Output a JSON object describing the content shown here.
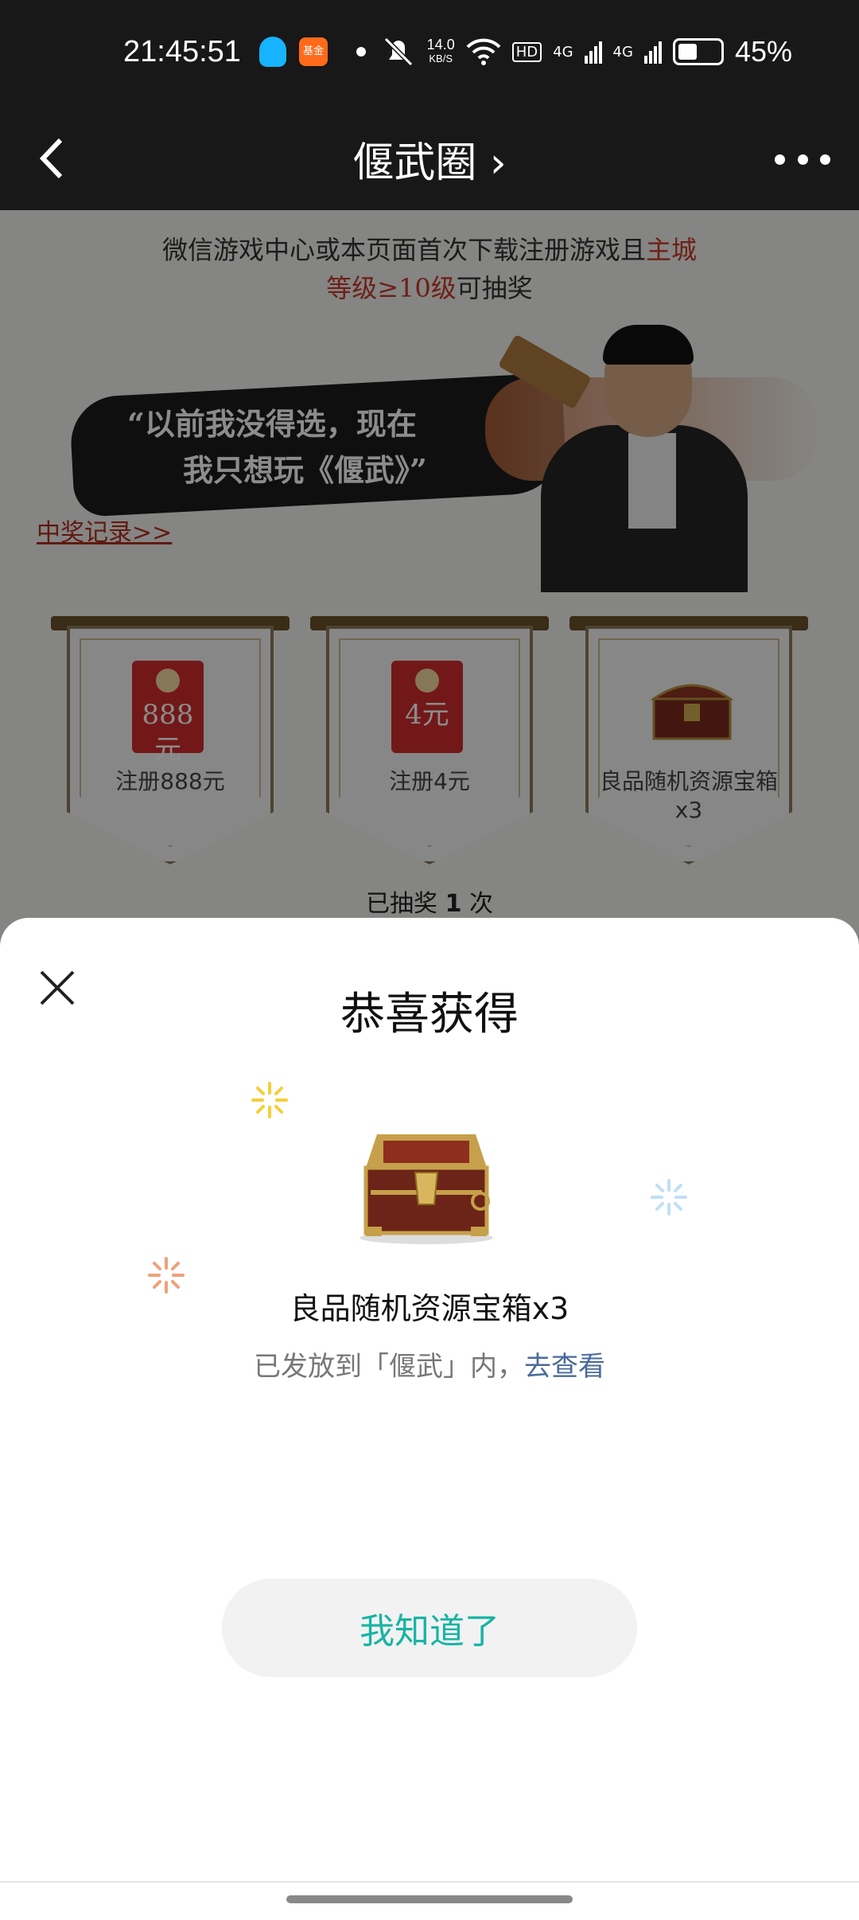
{
  "status_bar": {
    "time": "21:45:51",
    "fund_badge": "基金",
    "net_speed_value": "14.0",
    "net_speed_unit": "KB/S",
    "hd_label": "HD",
    "network_1": "4G",
    "network_2": "4G",
    "battery_percent": "45%",
    "battery_level": 0.45
  },
  "nav": {
    "title": "偃武圈 ›"
  },
  "page": {
    "notice_line1": "微信游戏中心或本页面首次下载注册游戏且",
    "notice_red1": "主城",
    "notice_red2": "等级≥10级",
    "notice_line2_tail": "可抽奖",
    "quote_line1": "“以前我没得选，现在",
    "quote_line2": "我只想玩《偃武》”",
    "record_link": "中奖记录>>",
    "prizes": [
      {
        "label": "注册888元",
        "amount": "888元",
        "icon": "red-envelope-icon"
      },
      {
        "label": "注册4元",
        "amount": "4元",
        "icon": "red-envelope-icon"
      },
      {
        "label": "良品随机资源宝箱x3",
        "icon": "treasure-chest-icon"
      }
    ],
    "drawn_prefix": "已抽奖 ",
    "drawn_count": "1",
    "drawn_suffix": " 次"
  },
  "sheet": {
    "title": "恭喜获得",
    "prize_name": "良品随机资源宝箱x3",
    "desc_text": "已发放到「偃武」内，",
    "desc_link": "去查看",
    "confirm_label": "我知道了",
    "accent_color": "#18b4a4",
    "link_color": "#4a6a9a"
  }
}
